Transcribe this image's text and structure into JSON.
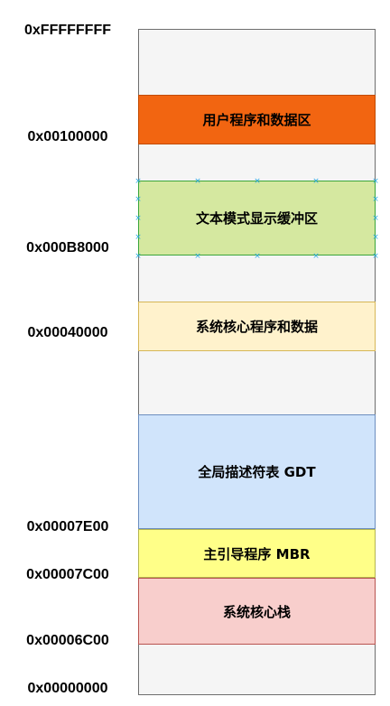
{
  "addresses": {
    "a_ffffffff": "0xFFFFFFFF",
    "a_00100000": "0x00100000",
    "a_000b8000": "0x000B8000",
    "a_00040000": "0x00040000",
    "a_00007e00": "0x00007E00",
    "a_00007c00": "0x00007C00",
    "a_00006c00": "0x00006C00",
    "a_00000000": "0x00000000"
  },
  "regions": {
    "user": {
      "label": "用户程序和数据区",
      "fill": "#f26511",
      "stroke": "#c24b00"
    },
    "text_buffer": {
      "label": "文本模式显示缓冲区",
      "fill": "#d5e8a0",
      "stroke": "#3aa53a"
    },
    "kernel": {
      "label": "系统核心程序和数据",
      "fill": "#fff2cc",
      "stroke": "#d6b656"
    },
    "gdt": {
      "label": "全局描述符表 GDT",
      "fill": "#d0e4fb",
      "stroke": "#6c8ebf"
    },
    "mbr": {
      "label": "主引导程序 MBR",
      "fill": "#ffff88",
      "stroke": "#b5b550"
    },
    "stack": {
      "label": "系统核心栈",
      "fill": "#f8cecc",
      "stroke": "#b85450"
    }
  }
}
